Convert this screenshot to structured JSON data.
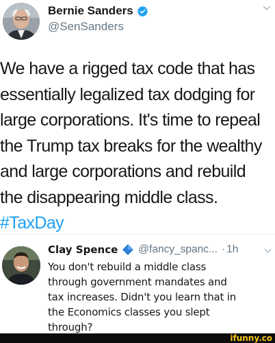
{
  "main_tweet": {
    "display_name": "Bernie Sanders",
    "handle": "@SenSanders",
    "body_lines": [
      "We have a rigged tax code that has",
      "essentially legalized tax dodging for",
      "large corporations. It's time to repeal",
      "the Trump tax breaks for the wealthy",
      "and large corporations and rebuild",
      "the disappearing middle class."
    ],
    "hashtag": "#TaxDay"
  },
  "reply": {
    "display_name": "Clay Spence",
    "handle": "@fancy_spanc...",
    "separator": "·",
    "time": "1h",
    "body_lines": [
      "You don't rebuild a middle class",
      "through government mandates and",
      "tax increases. Didn't you learn that in",
      "the Economics classes you slept",
      "through?"
    ]
  },
  "watermark": {
    "text": "ifunny.co"
  },
  "colors": {
    "text": "#14171a",
    "secondary": "#657786",
    "accent": "#1da1f2",
    "watermark": "#f6c417"
  }
}
